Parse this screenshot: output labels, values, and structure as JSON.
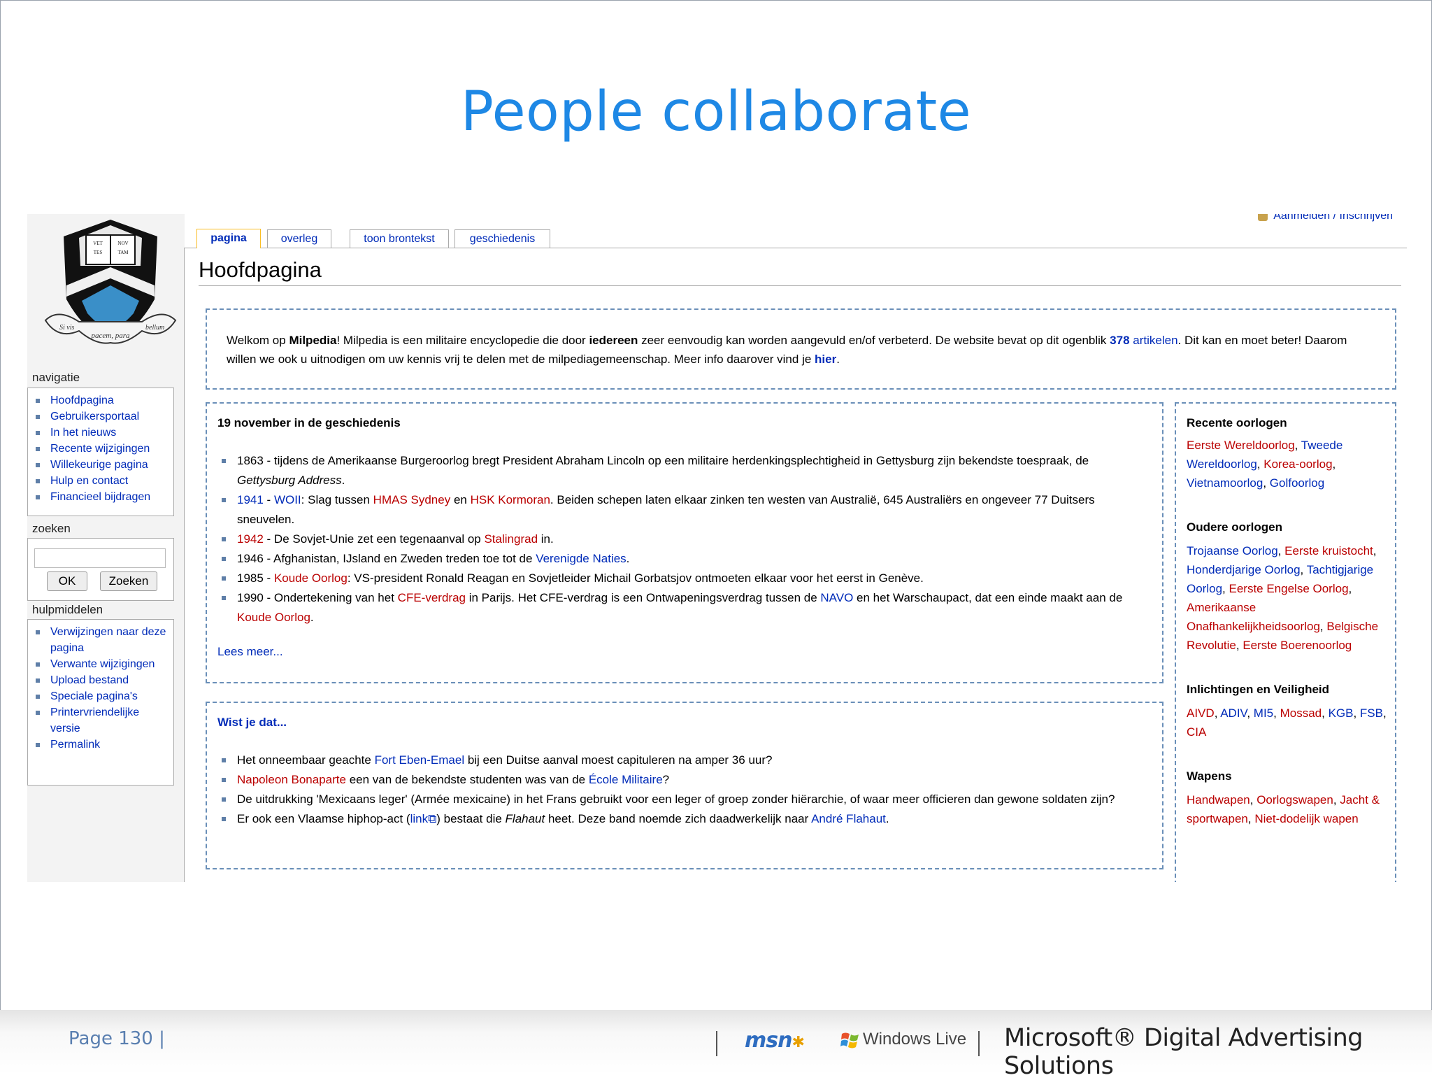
{
  "slide": {
    "title": "People collaborate",
    "page_label": "Page 130",
    "page_sep": "|",
    "brand_msn": "msn",
    "brand_windows_live": "Windows Live",
    "brand_microsoft": "Microsoft® Digital Advertising Solutions"
  },
  "wiki": {
    "login": "Aanmelden / Inschrijven",
    "tabs": [
      "pagina",
      "overleg",
      "toon brontekst",
      "geschiedenis"
    ],
    "page_title": "Hoofdpagina",
    "logo": {
      "motto_left": "Si vis",
      "motto_center": "pacem, para",
      "motto_right": "bellum",
      "book_text": "VET NOV TES TAM"
    },
    "nav": {
      "heading": "navigatie",
      "items": [
        "Hoofdpagina",
        "Gebruikersportaal",
        "In het nieuws",
        "Recente wijzigingen",
        "Willekeurige pagina",
        "Hulp en contact",
        "Financieel bijdragen"
      ]
    },
    "search": {
      "heading": "zoeken",
      "placeholder": "",
      "ok_label": "OK",
      "search_label": "Zoeken"
    },
    "tools": {
      "heading": "hulpmiddelen",
      "items": [
        "Verwijzingen naar deze pagina",
        "Verwante wijzigingen",
        "Upload bestand",
        "Speciale pagina's",
        "Printervriendelijke versie",
        "Permalink"
      ]
    },
    "welcome": {
      "t1": "Welkom op ",
      "b1": "Milpedia",
      "t2": "! Milpedia is een militaire encyclopedie die door ",
      "b2": "iedereen",
      "t3": " zeer eenvoudig kan worden aangevuld en/of verbeterd. De website bevat op dit ogenblik ",
      "count": "378",
      "t4": " ",
      "link_articles": "artikelen",
      "t5": ". Dit kan en moet beter! Daarom willen we ook u uitnodigen om uw kennis vrij te delen met de milpediagemeenschap. Meer info daarover vind je ",
      "link_here": "hier",
      "t6": "."
    },
    "history": {
      "heading": "19 november in de geschiedenis",
      "i1_t1": "1863 - tijdens de Amerikaanse Burgeroorlog bregt President Abraham Lincoln op een militaire herdenkingsplechtigheid in Gettysburg zijn bekendste toespraak, de ",
      "i1_em": "Gettysburg Address",
      "i1_t2": ".",
      "i2_l1": "1941",
      "i2_t1": " - ",
      "i2_l2": "WOII",
      "i2_t2": ": Slag tussen ",
      "i2_l3": "HMAS Sydney",
      "i2_t3": " en ",
      "i2_l4": "HSK Kormoran",
      "i2_t4": ". Beiden schepen laten elkaar zinken ten westen van Australië, 645 Australiërs en ongeveer 77 Duitsers sneuvelen.",
      "i3_l1": "1942",
      "i3_t1": " - De Sovjet-Unie zet een tegenaanval op ",
      "i3_l2": "Stalingrad",
      "i3_t2": " in.",
      "i4_t1": "1946 - Afghanistan, IJsland en Zweden treden toe tot de ",
      "i4_l1": "Verenigde Naties",
      "i4_t2": ".",
      "i5_t1": "1985 - ",
      "i5_l1": "Koude Oorlog",
      "i5_t2": ": VS-president Ronald Reagan en Sovjetleider Michail Gorbatsjov ontmoeten elkaar voor het eerst in Genève.",
      "i6_t1": "1990 - Ondertekening van het ",
      "i6_l1": "CFE-verdrag",
      "i6_t2": " in Parijs. Het CFE-verdrag is een Ontwapeningsverdrag tussen de ",
      "i6_l2": "NAVO",
      "i6_t3": " en het Warschaupact, dat een einde maakt aan de ",
      "i6_l3": "Koude Oorlog",
      "i6_t4": ".",
      "more": "Lees meer..."
    },
    "dyk": {
      "heading": "Wist je dat...",
      "i1_t1": "Het onneembaar geachte ",
      "i1_l1": "Fort Eben-Emael",
      "i1_t2": " bij een Duitse aanval moest capituleren na amper 36 uur?",
      "i2_l1": "Napoleon Bonaparte",
      "i2_t1": " een van de bekendste studenten was van de ",
      "i2_l2": "École Militaire",
      "i2_t2": "?",
      "i3_t1": "De uitdrukking 'Mexicaans leger' (Armée mexicaine) in het Frans gebruikt voor een leger of groep zonder hiërarchie, of waar meer officieren dan gewone soldaten zijn?",
      "i4_t1": "Er ook een Vlaamse hiphop-act (",
      "i4_l1": "link",
      "i4_t2": ") bestaat die ",
      "i4_em": "Flahaut",
      "i4_t3": " heet. Deze band noemde zich daadwerkelijk naar ",
      "i4_l2": "André Flahaut",
      "i4_t4": "."
    },
    "right": {
      "recent": {
        "heading": "Recente oorlogen",
        "l1": "Eerste Wereldoorlog",
        "s1": ", ",
        "l2": "Tweede Wereldoorlog",
        "s2": ", ",
        "l3": "Korea-oorlog",
        "s3": ", ",
        "l4": "Vietnamoorlog",
        "s4": ", ",
        "l5": "Golfoorlog"
      },
      "older": {
        "heading": "Oudere oorlogen",
        "l1": "Trojaanse Oorlog",
        "s1": ", ",
        "l2": "Eerste kruistocht",
        "s2": ", ",
        "l3": "Honderdjarige Oorlog",
        "s3": ", ",
        "l4": "Tachtigjarige Oorlog",
        "s4": ", ",
        "l5": "Eerste Engelse Oorlog",
        "s5": ", ",
        "l6": "Amerikaanse Onafhankelijkheidsoorlog",
        "s6": ", ",
        "l7": "Belgische Revolutie",
        "s7": ", ",
        "l8": "Eerste Boerenoorlog"
      },
      "intel": {
        "heading": "Inlichtingen en Veiligheid",
        "l1": "AIVD",
        "s1": ", ",
        "l2": "ADIV",
        "s2": ", ",
        "l3": "MI5",
        "s3": ", ",
        "l4": "Mossad",
        "s4": ", ",
        "l5": "KGB",
        "s5": ", ",
        "l6": "FSB",
        "s6": ", ",
        "l7": "CIA"
      },
      "weapons": {
        "heading": "Wapens",
        "l1": "Handwapen",
        "s1": ", ",
        "l2": "Oorlogswapen",
        "s2": ", ",
        "l3": "Jacht & sportwapen",
        "s3": ", ",
        "l4": "Niet-dodelijk wapen"
      }
    }
  },
  "colors": {
    "title_blue": "#1e88e5",
    "link_blue": "#002bb8",
    "link_red": "#ba0000",
    "dashed_border": "#6a8fb8"
  }
}
